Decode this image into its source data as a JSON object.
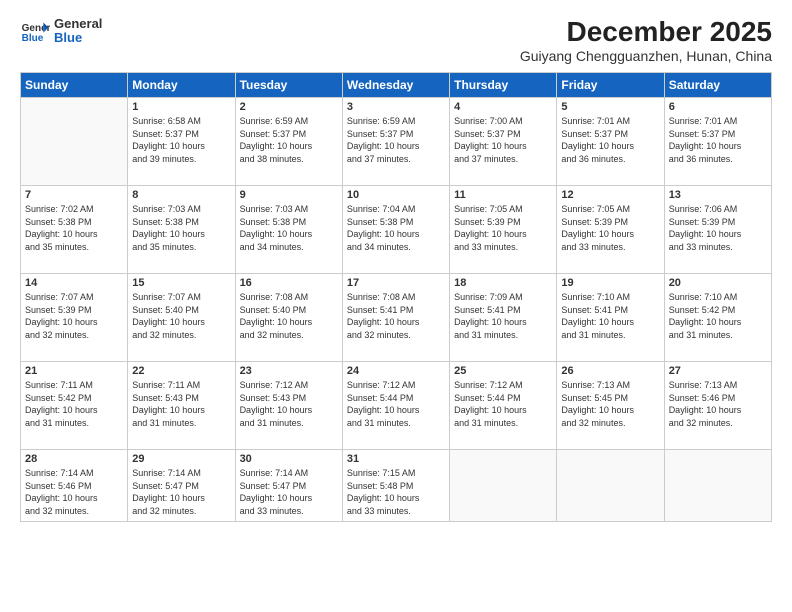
{
  "header": {
    "logo": {
      "general": "General",
      "blue": "Blue"
    },
    "title": "December 2025",
    "location": "Guiyang Chengguanzhen, Hunan, China"
  },
  "days_of_week": [
    "Sunday",
    "Monday",
    "Tuesday",
    "Wednesday",
    "Thursday",
    "Friday",
    "Saturday"
  ],
  "weeks": [
    [
      {
        "day": "",
        "info": ""
      },
      {
        "day": "1",
        "info": "Sunrise: 6:58 AM\nSunset: 5:37 PM\nDaylight: 10 hours\nand 39 minutes."
      },
      {
        "day": "2",
        "info": "Sunrise: 6:59 AM\nSunset: 5:37 PM\nDaylight: 10 hours\nand 38 minutes."
      },
      {
        "day": "3",
        "info": "Sunrise: 6:59 AM\nSunset: 5:37 PM\nDaylight: 10 hours\nand 37 minutes."
      },
      {
        "day": "4",
        "info": "Sunrise: 7:00 AM\nSunset: 5:37 PM\nDaylight: 10 hours\nand 37 minutes."
      },
      {
        "day": "5",
        "info": "Sunrise: 7:01 AM\nSunset: 5:37 PM\nDaylight: 10 hours\nand 36 minutes."
      },
      {
        "day": "6",
        "info": "Sunrise: 7:01 AM\nSunset: 5:37 PM\nDaylight: 10 hours\nand 36 minutes."
      }
    ],
    [
      {
        "day": "7",
        "info": "Sunrise: 7:02 AM\nSunset: 5:38 PM\nDaylight: 10 hours\nand 35 minutes."
      },
      {
        "day": "8",
        "info": "Sunrise: 7:03 AM\nSunset: 5:38 PM\nDaylight: 10 hours\nand 35 minutes."
      },
      {
        "day": "9",
        "info": "Sunrise: 7:03 AM\nSunset: 5:38 PM\nDaylight: 10 hours\nand 34 minutes."
      },
      {
        "day": "10",
        "info": "Sunrise: 7:04 AM\nSunset: 5:38 PM\nDaylight: 10 hours\nand 34 minutes."
      },
      {
        "day": "11",
        "info": "Sunrise: 7:05 AM\nSunset: 5:39 PM\nDaylight: 10 hours\nand 33 minutes."
      },
      {
        "day": "12",
        "info": "Sunrise: 7:05 AM\nSunset: 5:39 PM\nDaylight: 10 hours\nand 33 minutes."
      },
      {
        "day": "13",
        "info": "Sunrise: 7:06 AM\nSunset: 5:39 PM\nDaylight: 10 hours\nand 33 minutes."
      }
    ],
    [
      {
        "day": "14",
        "info": "Sunrise: 7:07 AM\nSunset: 5:39 PM\nDaylight: 10 hours\nand 32 minutes."
      },
      {
        "day": "15",
        "info": "Sunrise: 7:07 AM\nSunset: 5:40 PM\nDaylight: 10 hours\nand 32 minutes."
      },
      {
        "day": "16",
        "info": "Sunrise: 7:08 AM\nSunset: 5:40 PM\nDaylight: 10 hours\nand 32 minutes."
      },
      {
        "day": "17",
        "info": "Sunrise: 7:08 AM\nSunset: 5:41 PM\nDaylight: 10 hours\nand 32 minutes."
      },
      {
        "day": "18",
        "info": "Sunrise: 7:09 AM\nSunset: 5:41 PM\nDaylight: 10 hours\nand 31 minutes."
      },
      {
        "day": "19",
        "info": "Sunrise: 7:10 AM\nSunset: 5:41 PM\nDaylight: 10 hours\nand 31 minutes."
      },
      {
        "day": "20",
        "info": "Sunrise: 7:10 AM\nSunset: 5:42 PM\nDaylight: 10 hours\nand 31 minutes."
      }
    ],
    [
      {
        "day": "21",
        "info": "Sunrise: 7:11 AM\nSunset: 5:42 PM\nDaylight: 10 hours\nand 31 minutes."
      },
      {
        "day": "22",
        "info": "Sunrise: 7:11 AM\nSunset: 5:43 PM\nDaylight: 10 hours\nand 31 minutes."
      },
      {
        "day": "23",
        "info": "Sunrise: 7:12 AM\nSunset: 5:43 PM\nDaylight: 10 hours\nand 31 minutes."
      },
      {
        "day": "24",
        "info": "Sunrise: 7:12 AM\nSunset: 5:44 PM\nDaylight: 10 hours\nand 31 minutes."
      },
      {
        "day": "25",
        "info": "Sunrise: 7:12 AM\nSunset: 5:44 PM\nDaylight: 10 hours\nand 31 minutes."
      },
      {
        "day": "26",
        "info": "Sunrise: 7:13 AM\nSunset: 5:45 PM\nDaylight: 10 hours\nand 32 minutes."
      },
      {
        "day": "27",
        "info": "Sunrise: 7:13 AM\nSunset: 5:46 PM\nDaylight: 10 hours\nand 32 minutes."
      }
    ],
    [
      {
        "day": "28",
        "info": "Sunrise: 7:14 AM\nSunset: 5:46 PM\nDaylight: 10 hours\nand 32 minutes."
      },
      {
        "day": "29",
        "info": "Sunrise: 7:14 AM\nSunset: 5:47 PM\nDaylight: 10 hours\nand 32 minutes."
      },
      {
        "day": "30",
        "info": "Sunrise: 7:14 AM\nSunset: 5:47 PM\nDaylight: 10 hours\nand 33 minutes."
      },
      {
        "day": "31",
        "info": "Sunrise: 7:15 AM\nSunset: 5:48 PM\nDaylight: 10 hours\nand 33 minutes."
      },
      {
        "day": "",
        "info": ""
      },
      {
        "day": "",
        "info": ""
      },
      {
        "day": "",
        "info": ""
      }
    ]
  ]
}
